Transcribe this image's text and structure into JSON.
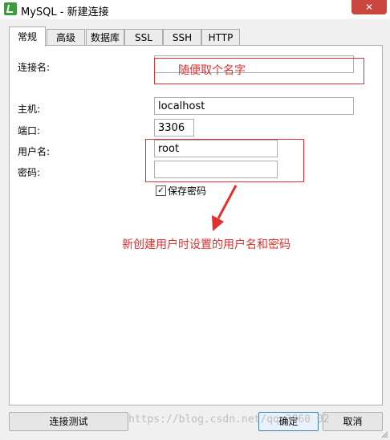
{
  "window": {
    "title": "MySQL - 新建连接",
    "close_glyph": "✕"
  },
  "tabs": [
    {
      "label": "常规",
      "active": true
    },
    {
      "label": "高级"
    },
    {
      "label": "数据库"
    },
    {
      "label": "SSL"
    },
    {
      "label": "SSH"
    },
    {
      "label": "HTTP"
    }
  ],
  "form": {
    "connection_name": {
      "label": "连接名:",
      "value": ""
    },
    "host": {
      "label": "主机:",
      "value": "localhost"
    },
    "port": {
      "label": "端口:",
      "value": "3306"
    },
    "username": {
      "label": "用户名:",
      "value": "root"
    },
    "password": {
      "label": "密码:",
      "value": ""
    },
    "save_password": {
      "label": "保存密码",
      "checked": true,
      "check_glyph": "✓"
    }
  },
  "annotations": {
    "name_hint": "随便取个名字",
    "user_hint": "新创建用户时设置的用户名和密码",
    "color": "#e03030"
  },
  "buttons": {
    "test": "连接测试",
    "ok": "确定",
    "cancel": "取消"
  },
  "watermark": "https://blog.csdn.net/qq_3860  02"
}
